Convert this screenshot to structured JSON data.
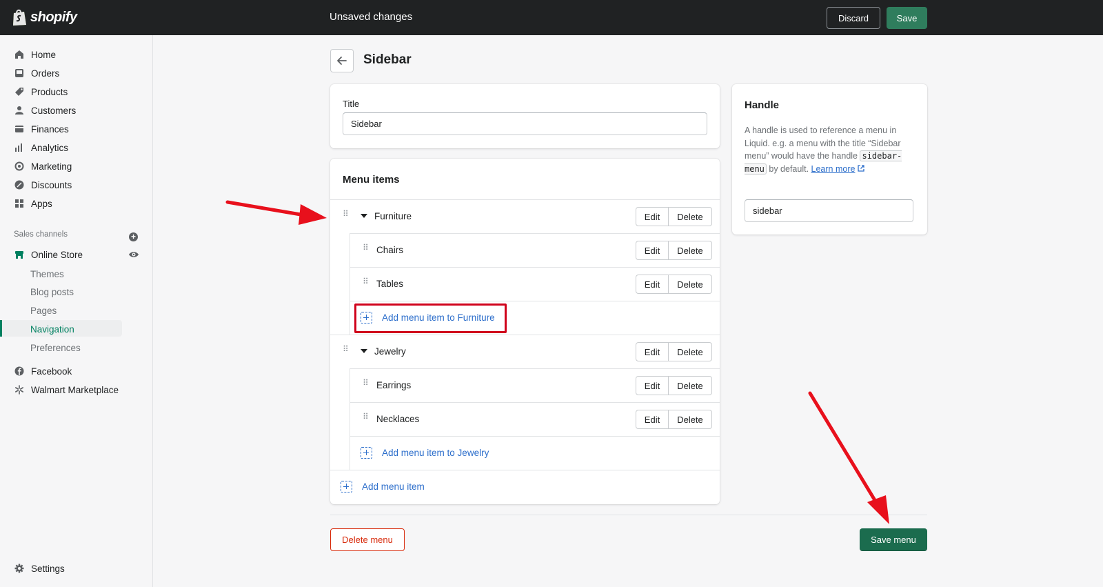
{
  "brand": {
    "logo_text": "shopify",
    "accent": "#008060",
    "topbar_bg": "#202223",
    "highlight": "#d0021b"
  },
  "topbar": {
    "status": "Unsaved changes",
    "discard_label": "Discard",
    "save_label": "Save"
  },
  "sidebar": {
    "items": [
      {
        "label": "Home",
        "icon": "home-icon"
      },
      {
        "label": "Orders",
        "icon": "orders-icon"
      },
      {
        "label": "Products",
        "icon": "tag-icon"
      },
      {
        "label": "Customers",
        "icon": "person-icon"
      },
      {
        "label": "Finances",
        "icon": "finance-icon"
      },
      {
        "label": "Analytics",
        "icon": "bar-chart-icon"
      },
      {
        "label": "Marketing",
        "icon": "target-icon"
      },
      {
        "label": "Discounts",
        "icon": "discount-icon"
      },
      {
        "label": "Apps",
        "icon": "apps-icon"
      }
    ],
    "sales_channels_label": "Sales channels",
    "online_store": {
      "label": "Online Store",
      "icon": "store-icon"
    },
    "online_store_subitems": [
      "Themes",
      "Blog posts",
      "Pages",
      "Navigation",
      "Preferences"
    ],
    "active_subitem": "Navigation",
    "channels": [
      {
        "label": "Facebook",
        "icon": "facebook-icon"
      },
      {
        "label": "Walmart Marketplace",
        "icon": "walmart-spark-icon"
      }
    ],
    "settings_label": "Settings"
  },
  "page": {
    "title": "Sidebar"
  },
  "title_card": {
    "label": "Title",
    "value": "Sidebar"
  },
  "menu_items": {
    "heading": "Menu items",
    "edit_label": "Edit",
    "delete_label": "Delete",
    "groups": [
      {
        "label": "Furniture",
        "children": [
          "Chairs",
          "Tables"
        ],
        "add_child_label": "Add menu item to Furniture"
      },
      {
        "label": "Jewelry",
        "children": [
          "Earrings",
          "Necklaces"
        ],
        "add_child_label": "Add menu item to Jewelry"
      }
    ],
    "add_item_label": "Add menu item"
  },
  "handle_card": {
    "title": "Handle",
    "desc_before": "A handle is used to reference a menu in Liquid. e.g. a menu with the title “Sidebar menu” would have the handle ",
    "desc_code": "sidebar-menu",
    "desc_after": " by default. ",
    "learn_more": "Learn more",
    "value": "sidebar"
  },
  "footer": {
    "delete_menu_label": "Delete menu",
    "save_menu_label": "Save menu"
  }
}
